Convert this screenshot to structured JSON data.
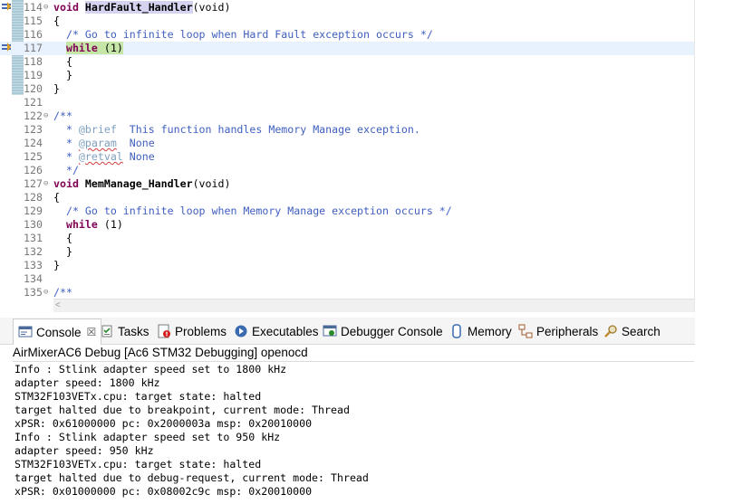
{
  "editor": {
    "lines": [
      {
        "num": "114",
        "fold": "⊖",
        "debug_mark": true,
        "current": false,
        "segs": [
          {
            "c": "kw",
            "t": "void"
          },
          {
            "c": "",
            "t": " "
          },
          {
            "c": "fn-hl",
            "t": "HardFault_Handler"
          },
          {
            "c": "",
            "t": "(void)"
          }
        ]
      },
      {
        "num": "115",
        "fold": "",
        "debug_mark": false,
        "current": false,
        "segs": [
          {
            "c": "",
            "t": "{"
          }
        ]
      },
      {
        "num": "116",
        "fold": "",
        "debug_mark": false,
        "current": false,
        "segs": [
          {
            "c": "",
            "t": "  "
          },
          {
            "c": "cm",
            "t": "/* Go to infinite loop when Hard Fault exception occurs */"
          }
        ]
      },
      {
        "num": "117",
        "fold": "",
        "debug_mark": true,
        "current": true,
        "segs": [
          {
            "c": "",
            "t": "  "
          },
          {
            "c": "kw hl-while",
            "t": "while"
          },
          {
            "c": "hl-while",
            "t": " (1)"
          }
        ]
      },
      {
        "num": "118",
        "fold": "",
        "debug_mark": false,
        "current": false,
        "segs": [
          {
            "c": "",
            "t": "  {"
          }
        ]
      },
      {
        "num": "119",
        "fold": "",
        "debug_mark": false,
        "current": false,
        "segs": [
          {
            "c": "",
            "t": "  }"
          }
        ]
      },
      {
        "num": "120",
        "fold": "",
        "debug_mark": false,
        "current": false,
        "segs": [
          {
            "c": "",
            "t": "}"
          }
        ]
      },
      {
        "num": "121",
        "fold": "",
        "debug_mark": false,
        "current": false,
        "segs": []
      },
      {
        "num": "122",
        "fold": "⊖",
        "debug_mark": false,
        "current": false,
        "segs": [
          {
            "c": "doc",
            "t": "/**"
          }
        ]
      },
      {
        "num": "123",
        "fold": "",
        "debug_mark": false,
        "current": false,
        "segs": [
          {
            "c": "doc",
            "t": "  * "
          },
          {
            "c": "doc-tag",
            "t": "@brief"
          },
          {
            "c": "doc",
            "t": "  This function handles Memory Manage exception."
          }
        ]
      },
      {
        "num": "124",
        "fold": "",
        "debug_mark": false,
        "current": false,
        "segs": [
          {
            "c": "doc",
            "t": "  * "
          },
          {
            "c": "doc-tag-u",
            "t": "@param"
          },
          {
            "c": "doc",
            "t": "  None"
          }
        ]
      },
      {
        "num": "125",
        "fold": "",
        "debug_mark": false,
        "current": false,
        "segs": [
          {
            "c": "doc",
            "t": "  * "
          },
          {
            "c": "doc-tag-u",
            "t": "@retval"
          },
          {
            "c": "doc",
            "t": " None"
          }
        ]
      },
      {
        "num": "126",
        "fold": "",
        "debug_mark": false,
        "current": false,
        "segs": [
          {
            "c": "doc",
            "t": "  */"
          }
        ]
      },
      {
        "num": "127",
        "fold": "⊖",
        "debug_mark": false,
        "current": false,
        "segs": [
          {
            "c": "kw",
            "t": "void"
          },
          {
            "c": "",
            "t": " "
          },
          {
            "c": "fn",
            "t": "MemManage_Handler"
          },
          {
            "c": "",
            "t": "(void)"
          }
        ]
      },
      {
        "num": "128",
        "fold": "",
        "debug_mark": false,
        "current": false,
        "segs": [
          {
            "c": "",
            "t": "{"
          }
        ]
      },
      {
        "num": "129",
        "fold": "",
        "debug_mark": false,
        "current": false,
        "segs": [
          {
            "c": "",
            "t": "  "
          },
          {
            "c": "cm",
            "t": "/* Go to infinite loop when Memory Manage exception occurs */"
          }
        ]
      },
      {
        "num": "130",
        "fold": "",
        "debug_mark": false,
        "current": false,
        "segs": [
          {
            "c": "",
            "t": "  "
          },
          {
            "c": "kw",
            "t": "while"
          },
          {
            "c": "",
            "t": " (1)"
          }
        ]
      },
      {
        "num": "131",
        "fold": "",
        "debug_mark": false,
        "current": false,
        "segs": [
          {
            "c": "",
            "t": "  {"
          }
        ]
      },
      {
        "num": "132",
        "fold": "",
        "debug_mark": false,
        "current": false,
        "segs": [
          {
            "c": "",
            "t": "  }"
          }
        ]
      },
      {
        "num": "133",
        "fold": "",
        "debug_mark": false,
        "current": false,
        "segs": [
          {
            "c": "",
            "t": "}"
          }
        ]
      },
      {
        "num": "134",
        "fold": "",
        "debug_mark": false,
        "current": false,
        "segs": []
      },
      {
        "num": "135",
        "fold": "⊖",
        "debug_mark": false,
        "current": false,
        "segs": [
          {
            "c": "doc",
            "t": "/**"
          }
        ]
      }
    ]
  },
  "tabs": [
    {
      "id": "console",
      "label": "Console",
      "icon": "console-icon",
      "active": true,
      "close_glyph": "☒"
    },
    {
      "id": "tasks",
      "label": "Tasks",
      "icon": "tasks-icon",
      "active": false
    },
    {
      "id": "problems",
      "label": "Problems",
      "icon": "problems-icon",
      "active": false
    },
    {
      "id": "executables",
      "label": "Executables",
      "icon": "executables-icon",
      "active": false
    },
    {
      "id": "debugger-console",
      "label": "Debugger Console",
      "icon": "debugger-console-icon",
      "active": false
    },
    {
      "id": "memory",
      "label": "Memory",
      "icon": "memory-icon",
      "active": false
    },
    {
      "id": "peripherals",
      "label": "Peripherals",
      "icon": "peripherals-icon",
      "active": false
    },
    {
      "id": "search",
      "label": "Search",
      "icon": "search-icon",
      "active": false
    }
  ],
  "console": {
    "title": "AirMixerAC6 Debug [Ac6 STM32 Debugging] openocd",
    "lines": [
      "Info : Stlink adapter speed set to 1800 kHz",
      "adapter speed: 1800 kHz",
      "STM32F103VETx.cpu: target state: halted",
      "target halted due to breakpoint, current mode: Thread",
      "xPSR: 0x61000000 pc: 0x2000003a msp: 0x20010000",
      "Info : Stlink adapter speed set to 950 kHz",
      "adapter speed: 950 kHz",
      "STM32F103VETx.cpu: target state: halted",
      "target halted due to debug-request, current mode: Thread",
      "xPSR: 0x01000000 pc: 0x08002c9c msp: 0x20010000"
    ]
  },
  "colors": {
    "keyword": "#7f0055",
    "comment": "#3f5fbf",
    "current_line": "#e8f2fe",
    "while_highlight": "#c6e6a8"
  }
}
